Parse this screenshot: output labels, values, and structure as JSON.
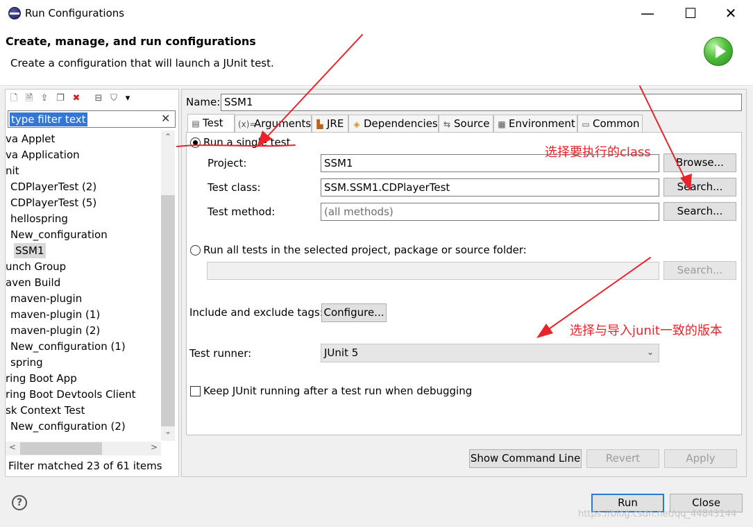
{
  "window": {
    "title": "Run Configurations",
    "minimize_glyph": "—",
    "maximize_glyph": "☐",
    "close_glyph": "✕"
  },
  "header": {
    "title": "Create, manage, and run configurations",
    "subtitle": "Create a configuration that will launch a JUnit test."
  },
  "left": {
    "toolbar_icons": [
      "new-config-icon",
      "new-prototype-icon",
      "export-icon",
      "duplicate-icon",
      "delete-icon",
      "collapse-all-icon",
      "filter-icon",
      "dropdown-icon"
    ],
    "filter_text": "type filter text",
    "filter_clear": "✕",
    "items": [
      "va Applet",
      "va Application",
      "nit",
      "CDPlayerTest (2)",
      "CDPlayerTest (5)",
      "hellospring",
      "New_configuration",
      "SSM1",
      "unch Group",
      "aven Build",
      "maven-plugin",
      "maven-plugin (1)",
      "maven-plugin (2)",
      "New_configuration (1)",
      "spring",
      "ring Boot App",
      "ring Boot Devtools Client",
      "sk Context Test",
      "New_configuration (2)"
    ],
    "selected_item": "SSM1",
    "status": "Filter matched 23 of 61 items",
    "scroll_up": "⌃",
    "scroll_down": "⌄",
    "scroll_left": "<",
    "scroll_right": ">"
  },
  "main": {
    "name_label": "Name:",
    "name_value": "SSM1",
    "tabs": [
      {
        "label": "Test",
        "icon": "test-icon",
        "glyph": "▤"
      },
      {
        "label": "Arguments",
        "icon": "arguments-icon",
        "glyph": "(x)="
      },
      {
        "label": "JRE",
        "icon": "jre-icon",
        "glyph": "▙"
      },
      {
        "label": "Dependencies",
        "icon": "dependencies-icon",
        "glyph": "◈"
      },
      {
        "label": "Source",
        "icon": "source-icon",
        "glyph": "⇆"
      },
      {
        "label": "Environment",
        "icon": "environment-icon",
        "glyph": "▦"
      },
      {
        "label": "Common",
        "icon": "common-icon",
        "glyph": "▭"
      }
    ],
    "active_tab": "Test",
    "single_test_label": "Run a single test",
    "project_label": "Project:",
    "project_value": "SSM1",
    "browse_button": "Browse...",
    "test_class_label": "Test class:",
    "test_class_value": "SSM.SSM1.CDPlayerTest",
    "search_button": "Search...",
    "test_method_label": "Test method:",
    "test_method_placeholder": "(all methods)",
    "search_button_2": "Search...",
    "all_tests_label": "Run all tests in the selected project, package or source folder:",
    "all_tests_value": "",
    "search_button_3": "Search...",
    "tags_label": "Include and exclude tags:",
    "configure_button": "Configure...",
    "runner_label": "Test runner:",
    "runner_value": "JUnit 5",
    "runner_arrow": "⌄",
    "keep_running_label": "Keep JUnit running after a test run when debugging",
    "keep_running_checked": false,
    "show_command_button": "Show Command Line",
    "revert_button": "Revert",
    "apply_button": "Apply"
  },
  "footer": {
    "help_glyph": "?",
    "run_button": "Run",
    "close_button": "Close",
    "watermark": "https://blog.csdn.net/qq_44843144"
  },
  "annotations": {
    "class_note": "选择要执行的class",
    "junit_note": "选择与导入junit一致的版本",
    "color": "#e8242a"
  }
}
